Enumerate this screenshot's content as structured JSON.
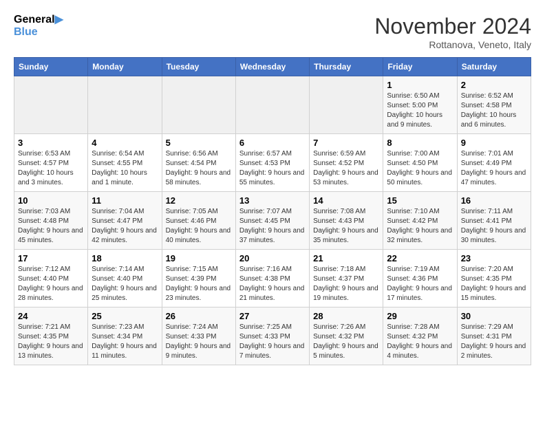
{
  "header": {
    "logo_line1": "General",
    "logo_line2": "Blue",
    "month": "November 2024",
    "location": "Rottanova, Veneto, Italy"
  },
  "weekdays": [
    "Sunday",
    "Monday",
    "Tuesday",
    "Wednesday",
    "Thursday",
    "Friday",
    "Saturday"
  ],
  "weeks": [
    [
      {
        "day": "",
        "info": ""
      },
      {
        "day": "",
        "info": ""
      },
      {
        "day": "",
        "info": ""
      },
      {
        "day": "",
        "info": ""
      },
      {
        "day": "",
        "info": ""
      },
      {
        "day": "1",
        "info": "Sunrise: 6:50 AM\nSunset: 5:00 PM\nDaylight: 10 hours and 9 minutes."
      },
      {
        "day": "2",
        "info": "Sunrise: 6:52 AM\nSunset: 4:58 PM\nDaylight: 10 hours and 6 minutes."
      }
    ],
    [
      {
        "day": "3",
        "info": "Sunrise: 6:53 AM\nSunset: 4:57 PM\nDaylight: 10 hours and 3 minutes."
      },
      {
        "day": "4",
        "info": "Sunrise: 6:54 AM\nSunset: 4:55 PM\nDaylight: 10 hours and 1 minute."
      },
      {
        "day": "5",
        "info": "Sunrise: 6:56 AM\nSunset: 4:54 PM\nDaylight: 9 hours and 58 minutes."
      },
      {
        "day": "6",
        "info": "Sunrise: 6:57 AM\nSunset: 4:53 PM\nDaylight: 9 hours and 55 minutes."
      },
      {
        "day": "7",
        "info": "Sunrise: 6:59 AM\nSunset: 4:52 PM\nDaylight: 9 hours and 53 minutes."
      },
      {
        "day": "8",
        "info": "Sunrise: 7:00 AM\nSunset: 4:50 PM\nDaylight: 9 hours and 50 minutes."
      },
      {
        "day": "9",
        "info": "Sunrise: 7:01 AM\nSunset: 4:49 PM\nDaylight: 9 hours and 47 minutes."
      }
    ],
    [
      {
        "day": "10",
        "info": "Sunrise: 7:03 AM\nSunset: 4:48 PM\nDaylight: 9 hours and 45 minutes."
      },
      {
        "day": "11",
        "info": "Sunrise: 7:04 AM\nSunset: 4:47 PM\nDaylight: 9 hours and 42 minutes."
      },
      {
        "day": "12",
        "info": "Sunrise: 7:05 AM\nSunset: 4:46 PM\nDaylight: 9 hours and 40 minutes."
      },
      {
        "day": "13",
        "info": "Sunrise: 7:07 AM\nSunset: 4:45 PM\nDaylight: 9 hours and 37 minutes."
      },
      {
        "day": "14",
        "info": "Sunrise: 7:08 AM\nSunset: 4:43 PM\nDaylight: 9 hours and 35 minutes."
      },
      {
        "day": "15",
        "info": "Sunrise: 7:10 AM\nSunset: 4:42 PM\nDaylight: 9 hours and 32 minutes."
      },
      {
        "day": "16",
        "info": "Sunrise: 7:11 AM\nSunset: 4:41 PM\nDaylight: 9 hours and 30 minutes."
      }
    ],
    [
      {
        "day": "17",
        "info": "Sunrise: 7:12 AM\nSunset: 4:40 PM\nDaylight: 9 hours and 28 minutes."
      },
      {
        "day": "18",
        "info": "Sunrise: 7:14 AM\nSunset: 4:40 PM\nDaylight: 9 hours and 25 minutes."
      },
      {
        "day": "19",
        "info": "Sunrise: 7:15 AM\nSunset: 4:39 PM\nDaylight: 9 hours and 23 minutes."
      },
      {
        "day": "20",
        "info": "Sunrise: 7:16 AM\nSunset: 4:38 PM\nDaylight: 9 hours and 21 minutes."
      },
      {
        "day": "21",
        "info": "Sunrise: 7:18 AM\nSunset: 4:37 PM\nDaylight: 9 hours and 19 minutes."
      },
      {
        "day": "22",
        "info": "Sunrise: 7:19 AM\nSunset: 4:36 PM\nDaylight: 9 hours and 17 minutes."
      },
      {
        "day": "23",
        "info": "Sunrise: 7:20 AM\nSunset: 4:35 PM\nDaylight: 9 hours and 15 minutes."
      }
    ],
    [
      {
        "day": "24",
        "info": "Sunrise: 7:21 AM\nSunset: 4:35 PM\nDaylight: 9 hours and 13 minutes."
      },
      {
        "day": "25",
        "info": "Sunrise: 7:23 AM\nSunset: 4:34 PM\nDaylight: 9 hours and 11 minutes."
      },
      {
        "day": "26",
        "info": "Sunrise: 7:24 AM\nSunset: 4:33 PM\nDaylight: 9 hours and 9 minutes."
      },
      {
        "day": "27",
        "info": "Sunrise: 7:25 AM\nSunset: 4:33 PM\nDaylight: 9 hours and 7 minutes."
      },
      {
        "day": "28",
        "info": "Sunrise: 7:26 AM\nSunset: 4:32 PM\nDaylight: 9 hours and 5 minutes."
      },
      {
        "day": "29",
        "info": "Sunrise: 7:28 AM\nSunset: 4:32 PM\nDaylight: 9 hours and 4 minutes."
      },
      {
        "day": "30",
        "info": "Sunrise: 7:29 AM\nSunset: 4:31 PM\nDaylight: 9 hours and 2 minutes."
      }
    ]
  ]
}
